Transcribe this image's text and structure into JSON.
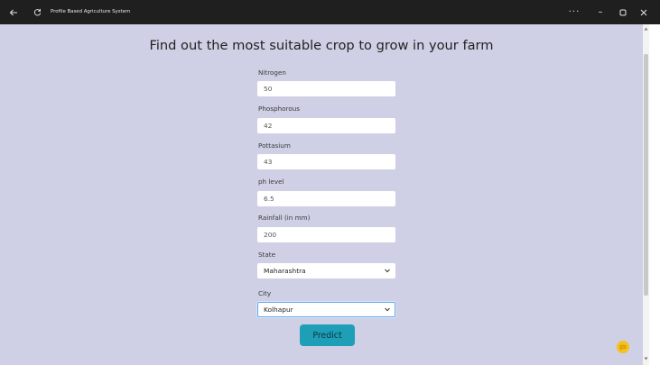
{
  "window": {
    "title": "Profile Based Agriculture System",
    "controls": {
      "more": "···",
      "minimize": "–",
      "maximize": "▫",
      "close": "✕"
    }
  },
  "page": {
    "heading": "Find out the most suitable crop to grow in your farm"
  },
  "form": {
    "nitrogen": {
      "label": "Nitrogen",
      "value": "50"
    },
    "phosphorous": {
      "label": "Phosphorous",
      "value": "42"
    },
    "pottasium": {
      "label": "Pottasium",
      "value": "43"
    },
    "ph": {
      "label": "ph level",
      "value": "6.5"
    },
    "rainfall": {
      "label": "Rainfall (in mm)",
      "value": "200"
    },
    "state": {
      "label": "State",
      "selected": "Maharashtra"
    },
    "city": {
      "label": "City",
      "selected": "Kolhapur"
    },
    "submit_label": "Predict"
  },
  "colors": {
    "background": "#cfd0e5",
    "button": "#1e9fb7",
    "chat_bubble": "#f3c21c",
    "titlebar": "#1f1f1f"
  },
  "icons": {
    "back": "arrow-left-icon",
    "refresh": "refresh-icon",
    "chevron": "chevron-down-icon",
    "chat": "chat-icon"
  }
}
